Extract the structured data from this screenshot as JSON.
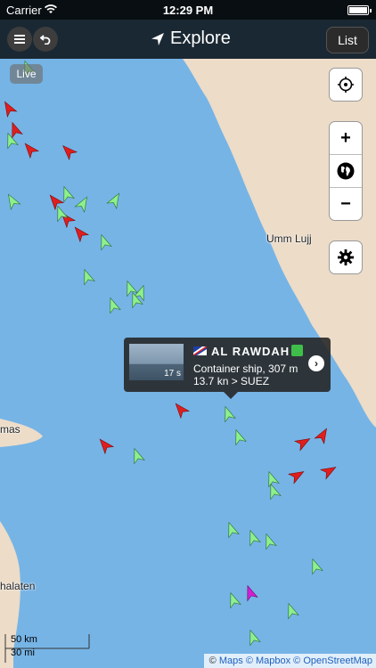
{
  "status_bar": {
    "carrier": "Carrier",
    "time": "12:29 PM"
  },
  "nav": {
    "title": "Explore",
    "list_label": "List",
    "menu_icon": "menu-icon",
    "back_icon": "undo-icon",
    "nav_icon": "location-arrow-icon"
  },
  "map": {
    "live_label": "Live",
    "places": [
      "Umm Lujj",
      "mas",
      "halaten"
    ],
    "controls": {
      "locate_icon": "crosshair-icon",
      "zoom_in": "+",
      "globe_icon": "globe-icon",
      "zoom_out": "−",
      "settings_icon": "gear-icon"
    },
    "scale": {
      "metric": "50 km",
      "imperial": "30 mi"
    },
    "attribution": {
      "maps": "Maps",
      "mapbox": "© Mapbox",
      "osm": "© OpenStreetMap",
      "prefix": "©"
    }
  },
  "popup": {
    "vessel_name": "AL RAWDAH",
    "description": "Container ship, 307 m",
    "speed_dest": "13.7 kn > SUEZ",
    "photo_age": "17 s"
  },
  "colors": {
    "sea": "#76b4e6",
    "land": "#ecdcc8",
    "cargo": "#8cf08c",
    "tanker": "#e01e1e",
    "other": "#d21ed2"
  }
}
